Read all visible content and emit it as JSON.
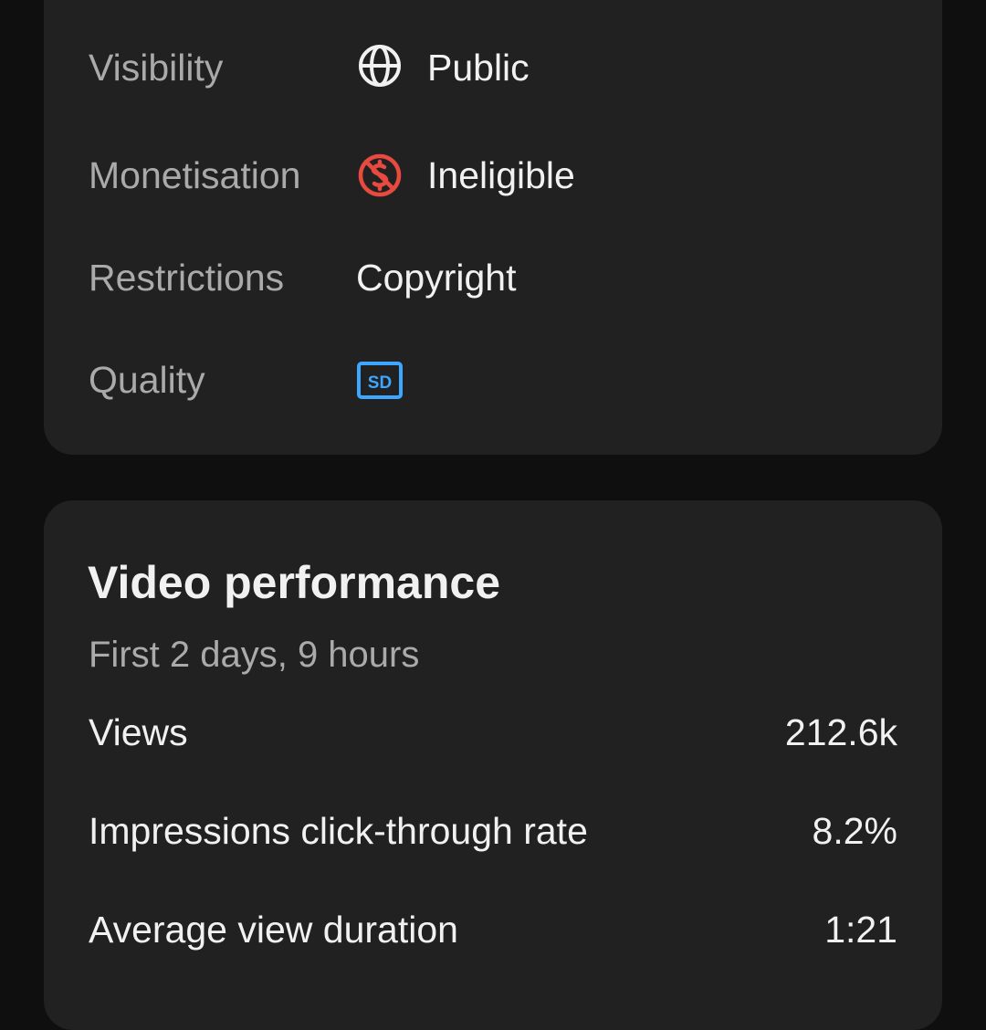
{
  "details": {
    "visibility": {
      "label": "Visibility",
      "value": "Public",
      "icon": "globe-icon"
    },
    "monetisation": {
      "label": "Monetisation",
      "value": "Ineligible",
      "icon": "monetisation-off-icon",
      "icon_color": "#e84a3f"
    },
    "restrictions": {
      "label": "Restrictions",
      "value": "Copyright"
    },
    "quality": {
      "label": "Quality",
      "badge_text": "SD",
      "icon": "sd-quality-icon",
      "badge_color": "#3ea6ff"
    }
  },
  "performance": {
    "title": "Video performance",
    "subtitle": "First 2 days, 9 hours",
    "metrics": [
      {
        "label": "Views",
        "value": "212.6k"
      },
      {
        "label": "Impressions click-through rate",
        "value": "8.2%"
      },
      {
        "label": "Average view duration",
        "value": "1:21"
      }
    ]
  },
  "colors": {
    "background": "#0f0f0f",
    "card": "#212121",
    "primary_text": "#f1f1f1",
    "secondary_text": "#aaaaaa"
  }
}
